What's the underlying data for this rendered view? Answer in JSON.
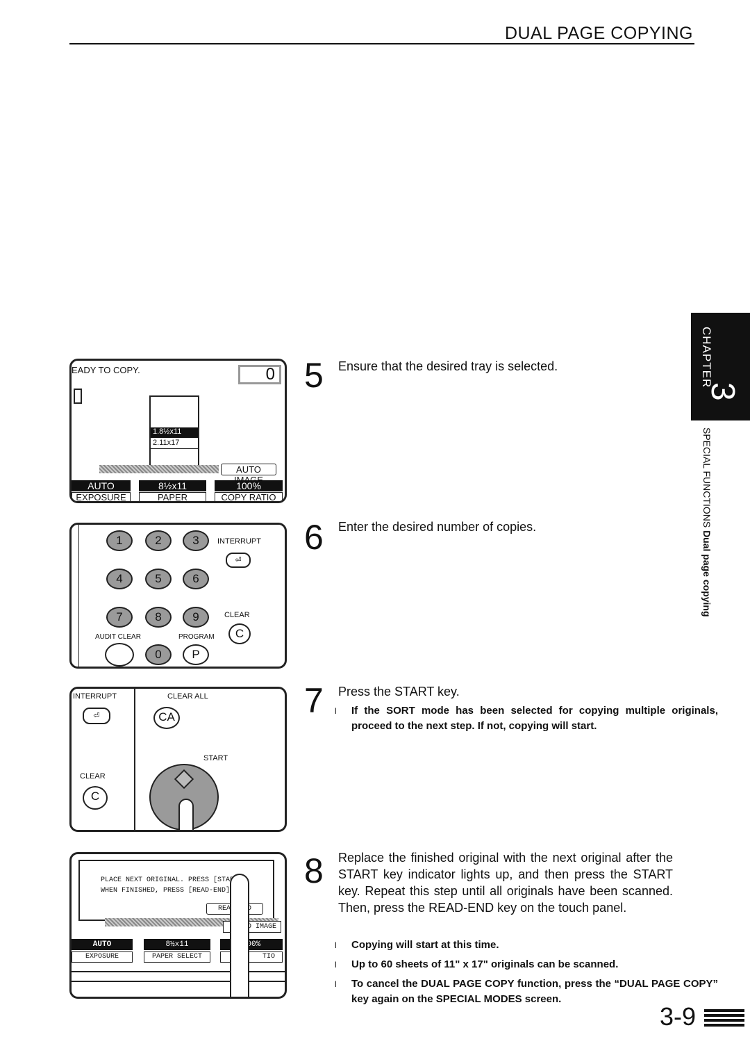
{
  "header": {
    "title": "DUAL PAGE COPYING"
  },
  "chapter_tab": {
    "label": "CHAPTER",
    "number": "3"
  },
  "side": {
    "section": "SPECIAL FUNCTIONS",
    "topic": "Dual page copying"
  },
  "screen1": {
    "message": "EADY TO COPY.",
    "count": "0",
    "tray1": "1.8½x11",
    "tray2": "2.11x17",
    "auto_image": "AUTO IMAGE",
    "exposure_value": "AUTO",
    "paper_value": "8½x11",
    "ratio_value": "100%",
    "exposure": "EXPOSURE",
    "paper_select": "PAPER SELECT",
    "copy_ratio": "COPY RATIO"
  },
  "keypad": {
    "keys": [
      "1",
      "2",
      "3",
      "4",
      "5",
      "6",
      "7",
      "8",
      "9",
      "0",
      "P"
    ],
    "interrupt": "INTERRUPT",
    "clear": "CLEAR",
    "clear_key": "C",
    "audit_clear": "AUDIT CLEAR",
    "program": "PROGRAM"
  },
  "start_panel": {
    "interrupt": "INTERRUPT",
    "clear_all": "CLEAR ALL",
    "ca": "CA",
    "start": "START",
    "clear": "CLEAR",
    "clear_key": "C"
  },
  "screen2": {
    "line1": "PLACE NEXT ORIGINAL. PRESS [START].",
    "line2": "WHEN FINISHED, PRESS [READ-END].",
    "read_end": "READ-END",
    "auto_image": "TO IMAGE",
    "exposure_value": "AUTO",
    "paper_value": "8½x11",
    "ratio_value": "100%",
    "exposure": "EXPOSURE",
    "paper_select": "PAPER SELECT",
    "copy_ratio": "TIO"
  },
  "steps": [
    {
      "number": "5",
      "text": "Ensure that the desired tray is selected."
    },
    {
      "number": "6",
      "text": "Enter the desired number of copies."
    },
    {
      "number": "7",
      "text": "Press the START key.",
      "notes": [
        "If the SORT mode has been selected for copying multiple originals, proceed to the next step. If not, copying will start."
      ]
    },
    {
      "number": "8",
      "text": "Replace the finished original with the next original after the START key indicator lights up, and then press the START key. Repeat this step until all originals have been scanned. Then, press the READ-END key on the touch panel.",
      "notes": [
        "Copying will start at this time.",
        "Up to 60 sheets of 11\" x 17\" originals can be scanned.",
        "To cancel the DUAL PAGE COPY function, press the “DUAL PAGE COPY” key again on the SPECIAL MODES screen."
      ]
    }
  ],
  "bullet": "l",
  "page_number": "3-9"
}
